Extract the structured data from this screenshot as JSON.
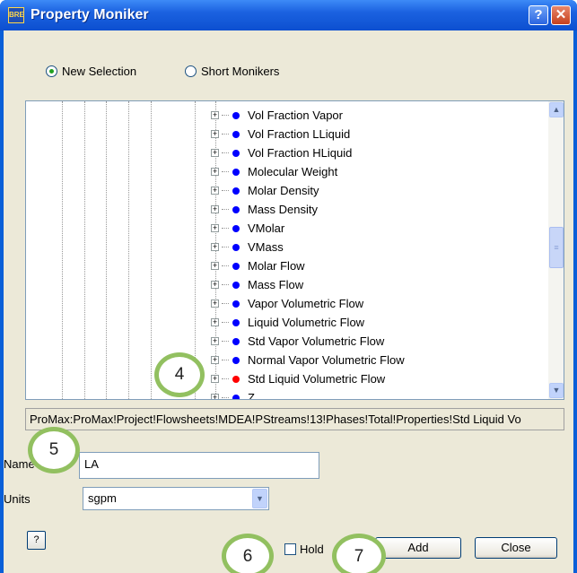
{
  "window": {
    "title": "Property Moniker",
    "help_button": "?",
    "close_button": "✕",
    "app_icon_text": "BRE"
  },
  "selection_mode": {
    "new_selection": "New Selection",
    "short_monikers": "Short Monikers",
    "selected": "New Selection"
  },
  "tree": {
    "items": [
      {
        "label": "Vol Fraction Vapor",
        "color": "#0000ff"
      },
      {
        "label": "Vol Fraction LLiquid",
        "color": "#0000ff"
      },
      {
        "label": "Vol Fraction HLiquid",
        "color": "#0000ff"
      },
      {
        "label": "Molecular Weight",
        "color": "#0000ff"
      },
      {
        "label": "Molar Density",
        "color": "#0000ff"
      },
      {
        "label": "Mass Density",
        "color": "#0000ff"
      },
      {
        "label": "VMolar",
        "color": "#0000ff"
      },
      {
        "label": "VMass",
        "color": "#0000ff"
      },
      {
        "label": "Molar Flow",
        "color": "#0000ff"
      },
      {
        "label": "Mass Flow",
        "color": "#0000ff"
      },
      {
        "label": "Vapor Volumetric Flow",
        "color": "#0000ff"
      },
      {
        "label": "Liquid Volumetric Flow",
        "color": "#0000ff"
      },
      {
        "label": "Std Vapor Volumetric Flow",
        "color": "#0000ff"
      },
      {
        "label": "Normal Vapor Volumetric Flow",
        "color": "#0000ff"
      },
      {
        "label": "Std Liquid Volumetric Flow",
        "color": "#ff0000"
      },
      {
        "label": "Z",
        "color": "#0000ff"
      }
    ],
    "expander_symbol": "+"
  },
  "moniker_path": "ProMax:ProMax!Project!Flowsheets!MDEA!PStreams!13!Phases!Total!Properties!Std Liquid Vo",
  "name_field": {
    "label": "Name",
    "value": "LA"
  },
  "units_field": {
    "label": "Units",
    "value": "sgpm"
  },
  "footer": {
    "help_icon": "?",
    "hold_label": "Hold",
    "add_label": "Add",
    "close_label": "Close"
  },
  "callouts": {
    "c4": "4",
    "c5": "5",
    "c6": "6",
    "c7": "7"
  }
}
